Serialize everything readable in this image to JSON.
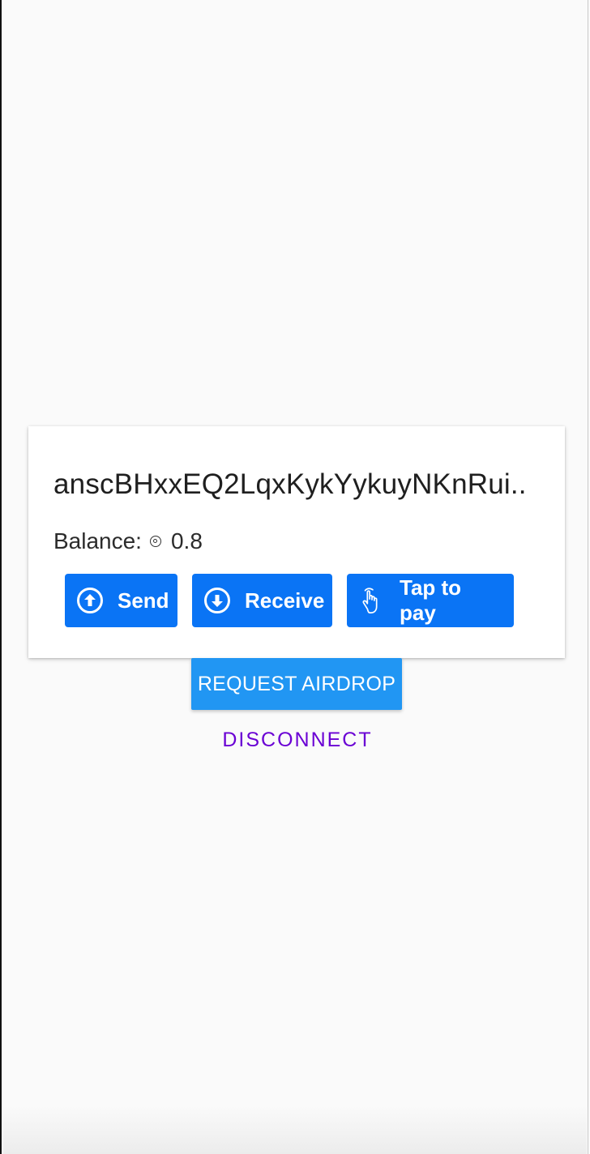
{
  "wallet": {
    "address": "anscBHxxEQ2LqxKykYykuyNKnRui..",
    "balance_label": "Balance:",
    "balance_value": "0.8",
    "currency_icon": "sol-icon"
  },
  "actions": [
    {
      "label": "Send",
      "icon": "arrow-up-circle-icon"
    },
    {
      "label": "Receive",
      "icon": "arrow-down-circle-icon"
    },
    {
      "label": "Tap to pay",
      "icon": "tap-hand-icon"
    }
  ],
  "airdrop_button": {
    "label": "REQUEST AIRDROP"
  },
  "disconnect_button": {
    "label": "DISCONNECT"
  },
  "colors": {
    "action_blue": "#0a74f5",
    "airdrop_blue": "#2196f3",
    "disconnect_purple": "#6a00d4",
    "background": "#fafafa"
  }
}
